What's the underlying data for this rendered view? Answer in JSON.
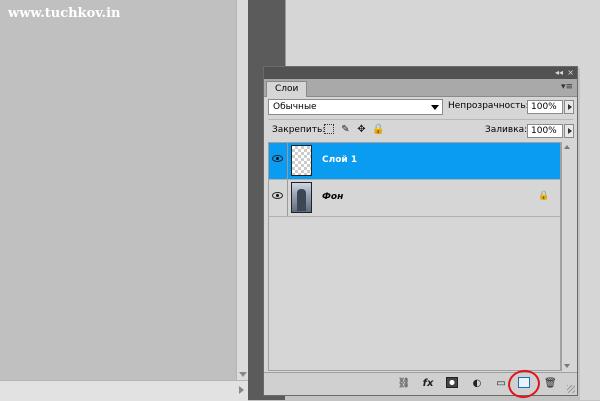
{
  "watermark": "www.tuchkov.in",
  "panel": {
    "tab_label": "Слои",
    "titlebar_collapse": "◂◂",
    "titlebar_close": "×",
    "menu_icon": "▾≡",
    "blend_mode": "Обычные",
    "opacity_label": "Непрозрачность:",
    "opacity_value": "100%",
    "lock_label": "Закрепить:",
    "fill_label": "Заливка:",
    "fill_value": "100%",
    "lock_icons": [
      "lock-transparent-icon",
      "lock-brush-icon",
      "lock-move-icon",
      "lock-all-icon"
    ]
  },
  "layers": [
    {
      "name": "Слой 1",
      "selected": true,
      "visible": true,
      "thumbnail": "transparent"
    },
    {
      "name": "Фон",
      "selected": false,
      "visible": true,
      "thumbnail": "photo",
      "locked": true
    }
  ],
  "footer_icons": [
    "link-icon",
    "fx-icon",
    "mask-icon",
    "adjustment-icon",
    "folder-icon",
    "new-layer-icon",
    "trash-icon"
  ],
  "fx_label": "fx",
  "colors": {
    "selection": "#0a9cf0",
    "annotation": "#e0141e"
  }
}
